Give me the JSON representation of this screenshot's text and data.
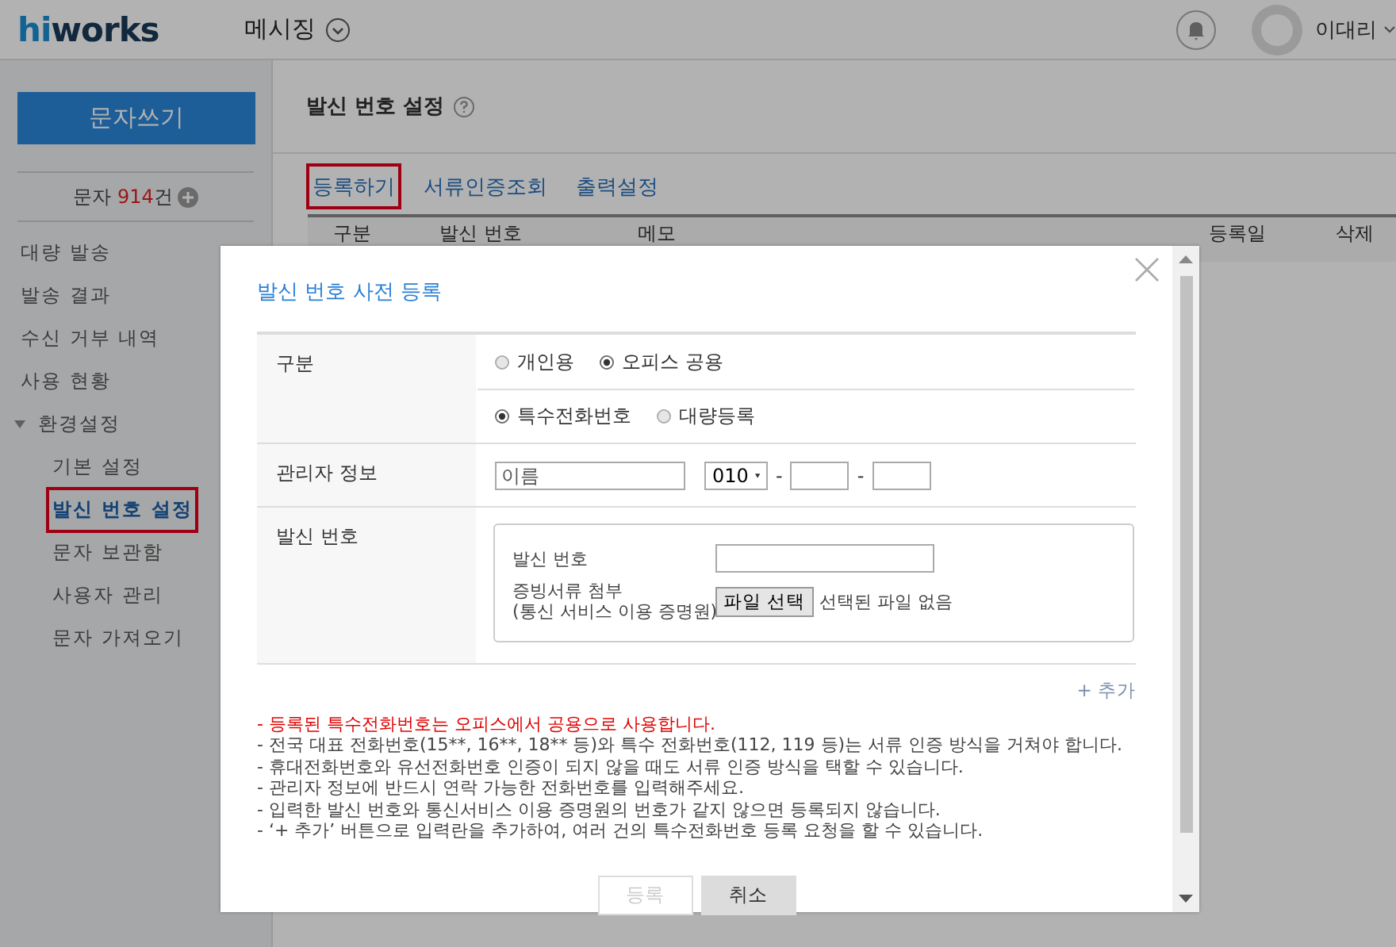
{
  "header": {
    "logo": {
      "accent": "hi",
      "rest": "works"
    },
    "menu": "메시징",
    "user": "이대리"
  },
  "sidebar": {
    "compose_button": "문자쓰기",
    "credit": {
      "label": "문자",
      "count": "914",
      "unit": "건"
    },
    "items": [
      {
        "label": "대량 발송",
        "selected": false
      },
      {
        "label": "발송 결과",
        "selected": false
      },
      {
        "label": "수신 거부 내역",
        "selected": false
      },
      {
        "label": "사용 현황",
        "selected": false
      },
      {
        "label": "환경설정",
        "selected": false,
        "expanded": true,
        "children": [
          {
            "label": "기본 설정",
            "selected": false
          },
          {
            "label": "발신 번호 설정",
            "selected": true
          },
          {
            "label": "문자 보관함",
            "selected": false
          },
          {
            "label": "사용자 관리",
            "selected": false
          },
          {
            "label": "문자 가져오기",
            "selected": false
          }
        ]
      }
    ]
  },
  "page": {
    "title": "발신 번호 설정",
    "tabs": [
      {
        "label": "등록하기",
        "selected": true
      },
      {
        "label": "서류인증조회",
        "selected": false
      },
      {
        "label": "출력설정",
        "selected": false
      }
    ],
    "table": {
      "columns": [
        "구분",
        "발신 번호",
        "메모",
        "등록일",
        "삭제"
      ]
    }
  },
  "dialog": {
    "title": "발신 번호 사전 등록",
    "category": {
      "label": "구분",
      "groups": [
        [
          {
            "label": "개인용",
            "selected": false
          },
          {
            "label": "오피스 공용",
            "selected": true
          }
        ],
        [
          {
            "label": "특수전화번호",
            "selected": true
          },
          {
            "label": "대량등록",
            "selected": false
          }
        ]
      ]
    },
    "manager": {
      "label": "관리자 정보",
      "name_placeholder": "이름",
      "prefix": "010",
      "separators": [
        "-",
        "-"
      ]
    },
    "sender": {
      "label": "발신 번호",
      "number_label": "발신 번호",
      "attach_label": "증빙서류 첨부",
      "attach_note": "(통신 서비스 이용 증명원)",
      "file_button": "파일 선택",
      "file_status": "선택된 파일 없음"
    },
    "add_link": "+ 추가",
    "notes": [
      {
        "kind": "warning",
        "text": "- 등록된 특수전화번호는 오피스에서 공용으로 사용합니다."
      },
      {
        "kind": "info",
        "text": "- 전국 대표 전화번호(15**, 16**, 18** 등)와 특수 전화번호(112, 119 등)는 서류 인증 방식을 거쳐야 합니다."
      },
      {
        "kind": "info",
        "text": "- 휴대전화번호와 유선전화번호 인증이 되지 않을 때도 서류 인증 방식을 택할 수 있습니다."
      },
      {
        "kind": "info",
        "text": "- 관리자 정보에 반드시 연락 가능한 전화번호를 입력해주세요."
      },
      {
        "kind": "info",
        "text": "- 입력한 발신 번호와 통신서비스 이용 증명원의 번호가 같지 않으면 등록되지 않습니다."
      },
      {
        "kind": "info",
        "text": "- ‘+ 추가’ 버튼으로 입력란을 추가하여, 여러 건의 특수전화번호 등록 요청을 할 수 있습니다."
      }
    ],
    "buttons": [
      {
        "label": "등록",
        "disabled": true
      },
      {
        "label": "취소",
        "disabled": false
      }
    ]
  }
}
